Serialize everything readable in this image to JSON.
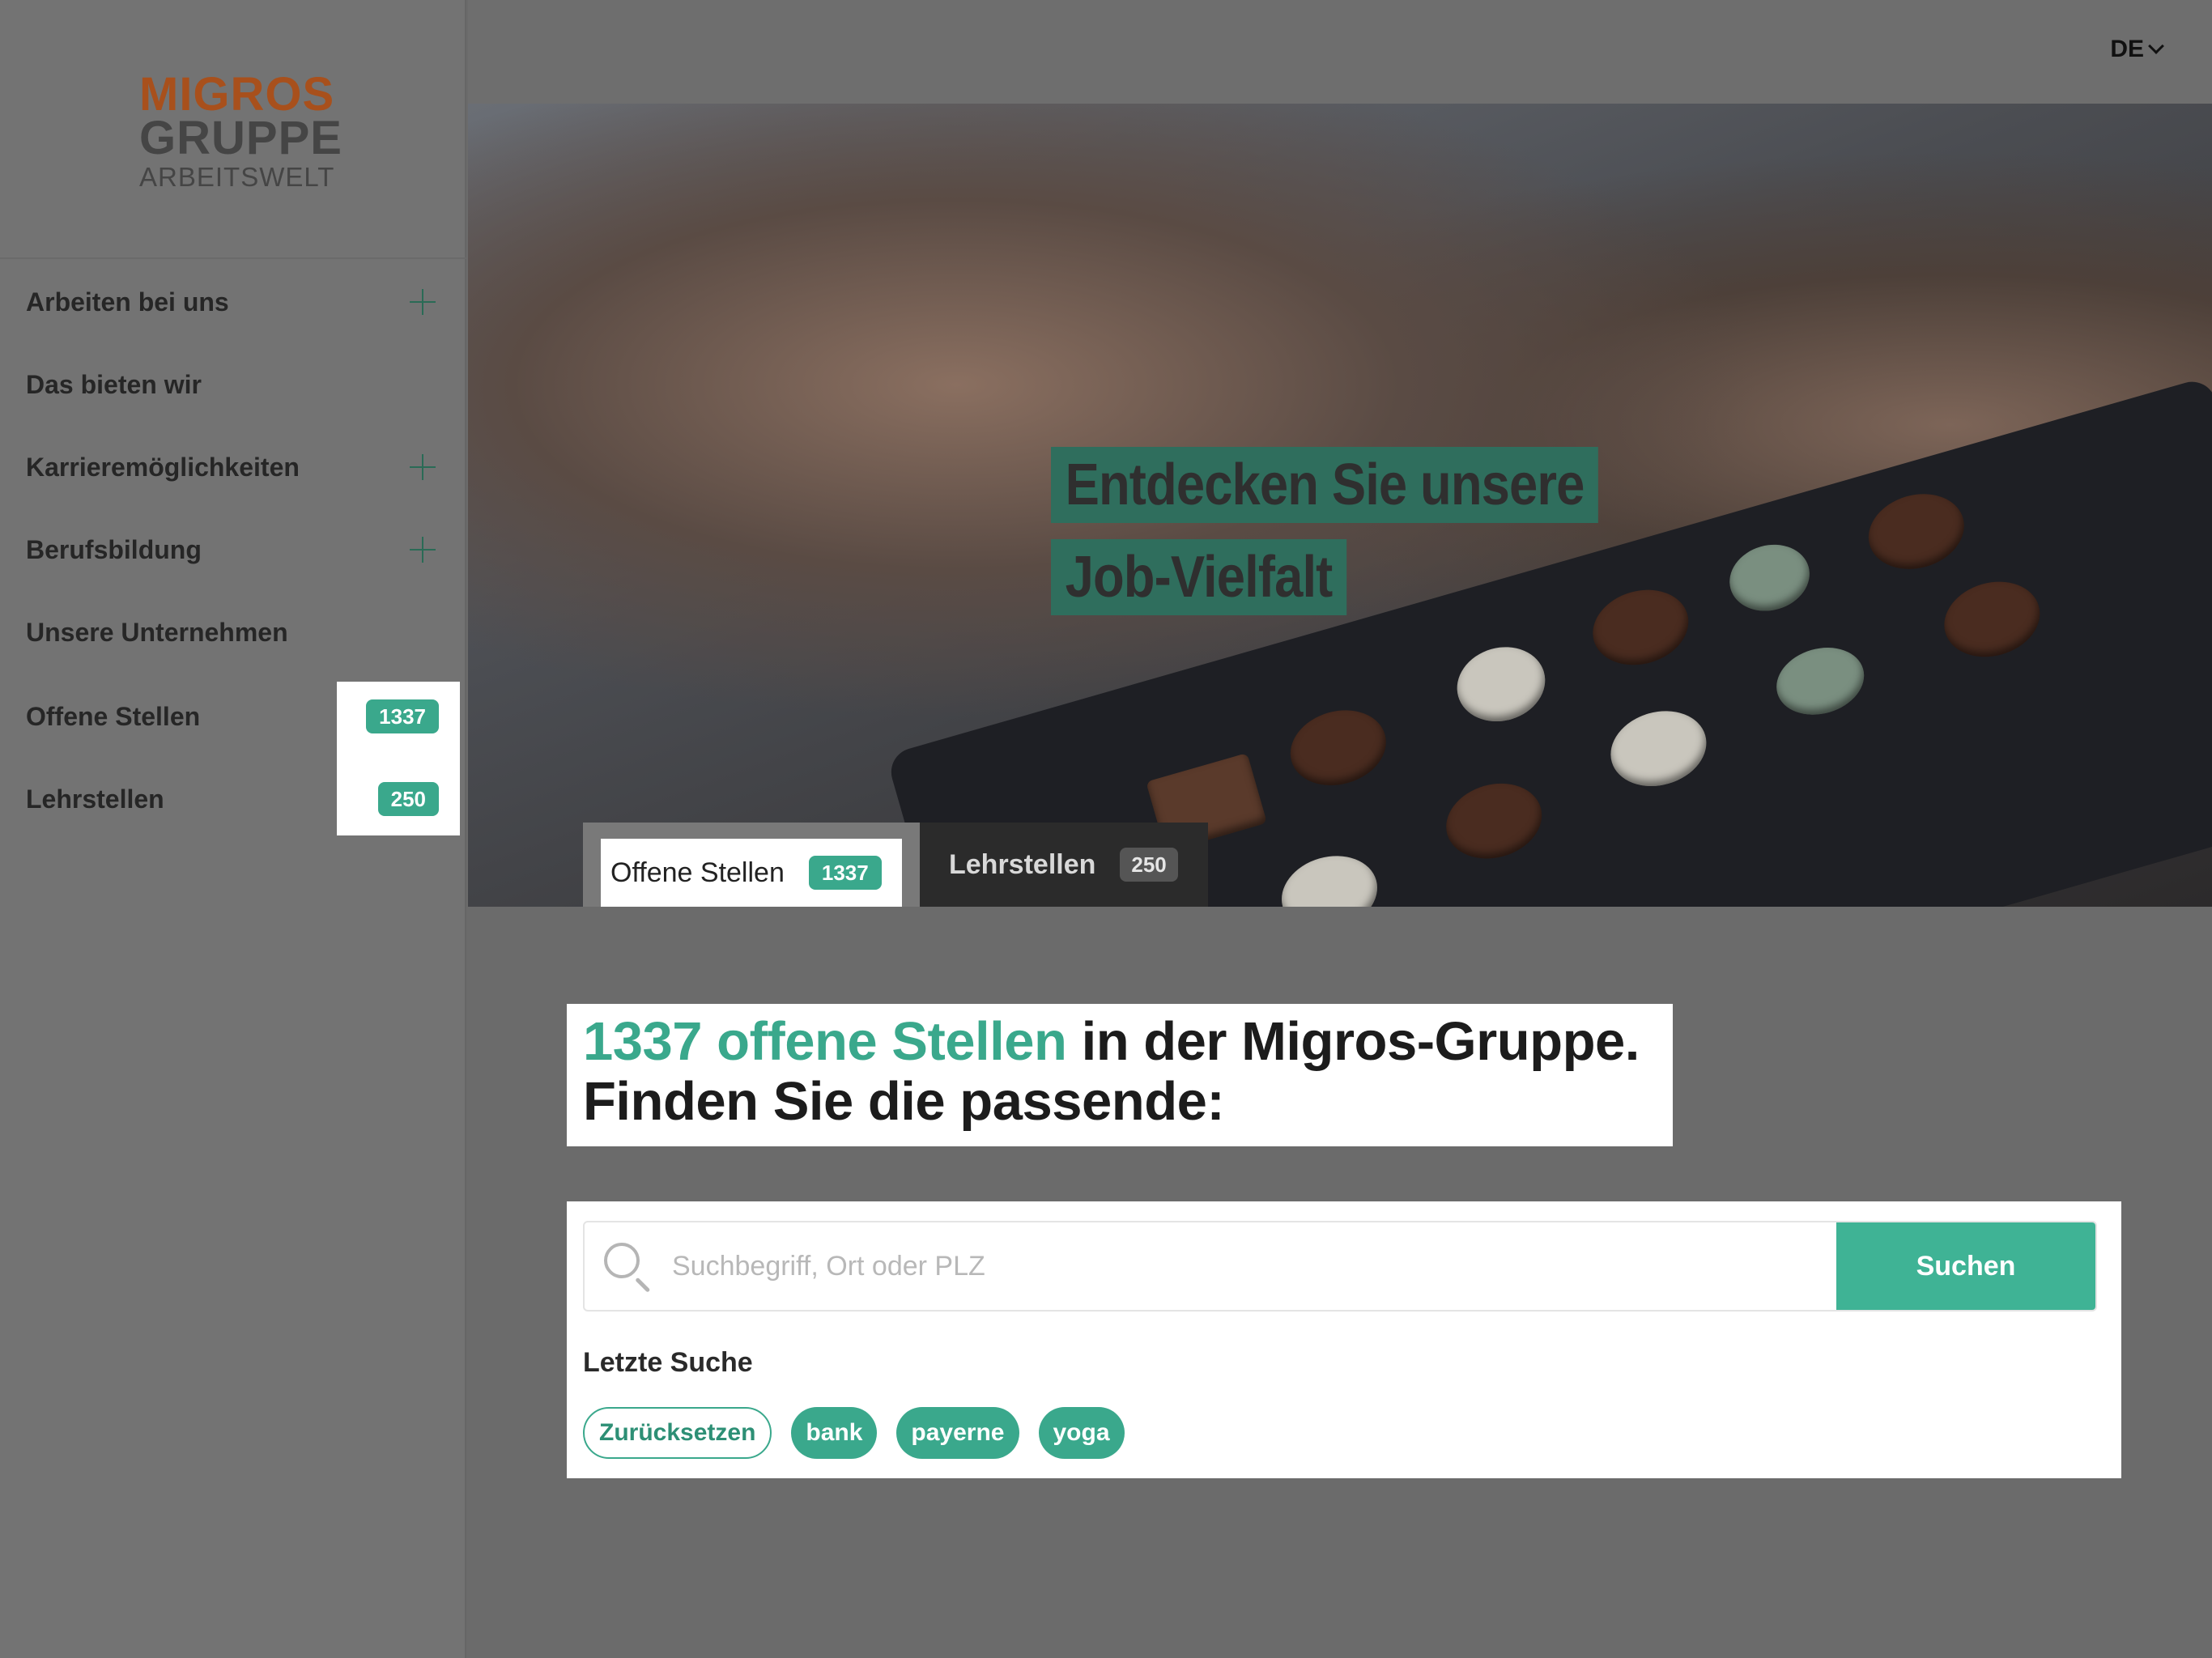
{
  "brand": {
    "line1": "MIGROS",
    "line2": "GRUPPE",
    "line3": "ARBEITSWELT"
  },
  "colors": {
    "accent": "#3aa88c",
    "brand_orange": "#a8501c"
  },
  "sidebar": {
    "items": [
      {
        "label": "Arbeiten bei uns",
        "expandable": true
      },
      {
        "label": "Das bieten wir",
        "expandable": false
      },
      {
        "label": "Karrieremöglichkeiten",
        "expandable": true
      },
      {
        "label": "Berufsbildung",
        "expandable": true
      },
      {
        "label": "Unsere Unternehmen",
        "expandable": false
      },
      {
        "label": "Offene Stellen",
        "badge": "1337"
      },
      {
        "label": "Lehrstellen",
        "badge": "250"
      }
    ]
  },
  "header": {
    "language": "DE"
  },
  "hero": {
    "title_line1": "Entdecken Sie unsere",
    "title_line2": "Job-Vielfalt",
    "tabs": [
      {
        "label": "Offene Stellen",
        "count": "1337",
        "active": true
      },
      {
        "label": "Lehrstellen",
        "count": "250",
        "active": false
      }
    ]
  },
  "main": {
    "headline_accent": "1337 offene Stellen",
    "headline_rest": " in der Migros-Gruppe.",
    "headline_line2": "Finden Sie die passende:"
  },
  "search": {
    "placeholder": "Suchbegriff, Ort oder PLZ",
    "value": "",
    "button_label": "Suchen",
    "recent_title": "Letzte Suche",
    "reset_label": "Zurücksetzen",
    "recent_terms": [
      "bank",
      "payerne",
      "yoga"
    ]
  }
}
